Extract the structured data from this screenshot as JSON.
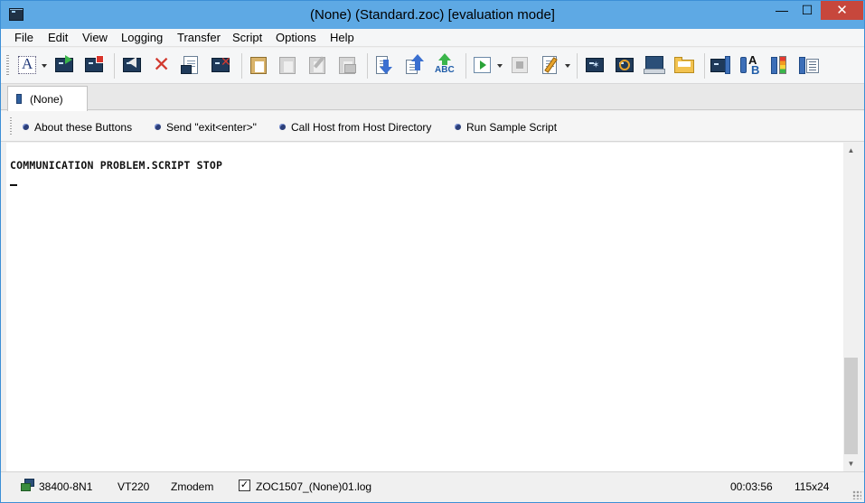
{
  "window": {
    "title": "(None) (Standard.zoc) [evaluation mode]",
    "controls": {
      "minimize": "—",
      "maximize": "☐",
      "close": "✕"
    }
  },
  "menu": {
    "file": "File",
    "edit": "Edit",
    "view": "View",
    "logging": "Logging",
    "transfer": "Transfer",
    "script": "Script",
    "options": "Options",
    "help": "Help"
  },
  "toolbar": {
    "icons": [
      "font-icon",
      "new-session-icon",
      "quick-connect-icon",
      "disconnect-icon",
      "cancel-icon",
      "properties-icon",
      "clear-icon",
      "paste-icon",
      "copy-icon",
      "edit-icon",
      "print-icon",
      "download-icon",
      "upload-icon",
      "spell-check-icon",
      "run-script-icon",
      "stop-icon",
      "edit-script-icon",
      "terminal-icon",
      "target-icon",
      "host-directory-icon",
      "open-folder-icon",
      "window-icon",
      "text-style-icon",
      "color-bars-icon",
      "settings-icon"
    ]
  },
  "tab": {
    "label": "(None)"
  },
  "button_bar": {
    "buttons": [
      "About these Buttons",
      "Send \"exit<enter>\"",
      "Call Host from Host Directory",
      "Run Sample Script"
    ]
  },
  "terminal": {
    "lines": [
      "COMMUNICATION PROBLEM.SCRIPT STOP"
    ]
  },
  "status": {
    "connection": "38400-8N1",
    "emulation": "VT220",
    "transfer": "Zmodem",
    "log_file": "ZOC1507_(None)01.log",
    "log_enabled": true,
    "elapsed": "00:03:56",
    "size": "115x24"
  },
  "colors": {
    "titlebar": "#5ea9e4",
    "close_button": "#c7473c",
    "terminal_background": "#ffffff"
  }
}
